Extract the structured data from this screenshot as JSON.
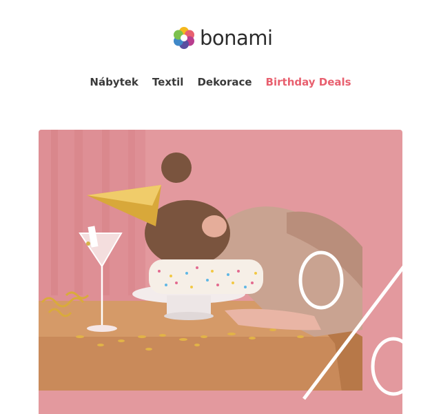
{
  "brand": {
    "name": "bonami",
    "colors": {
      "accent": "#e8606f",
      "text": "#2c2c2c",
      "hero_background": "#e3999e"
    }
  },
  "nav": {
    "items": [
      {
        "label": "Nábytek",
        "highlight": false
      },
      {
        "label": "Textil",
        "highlight": false
      },
      {
        "label": "Dekorace",
        "highlight": false
      },
      {
        "label": "Birthday Deals",
        "highlight": true
      }
    ]
  },
  "hero": {
    "icon": "percent-sign-graphic"
  }
}
